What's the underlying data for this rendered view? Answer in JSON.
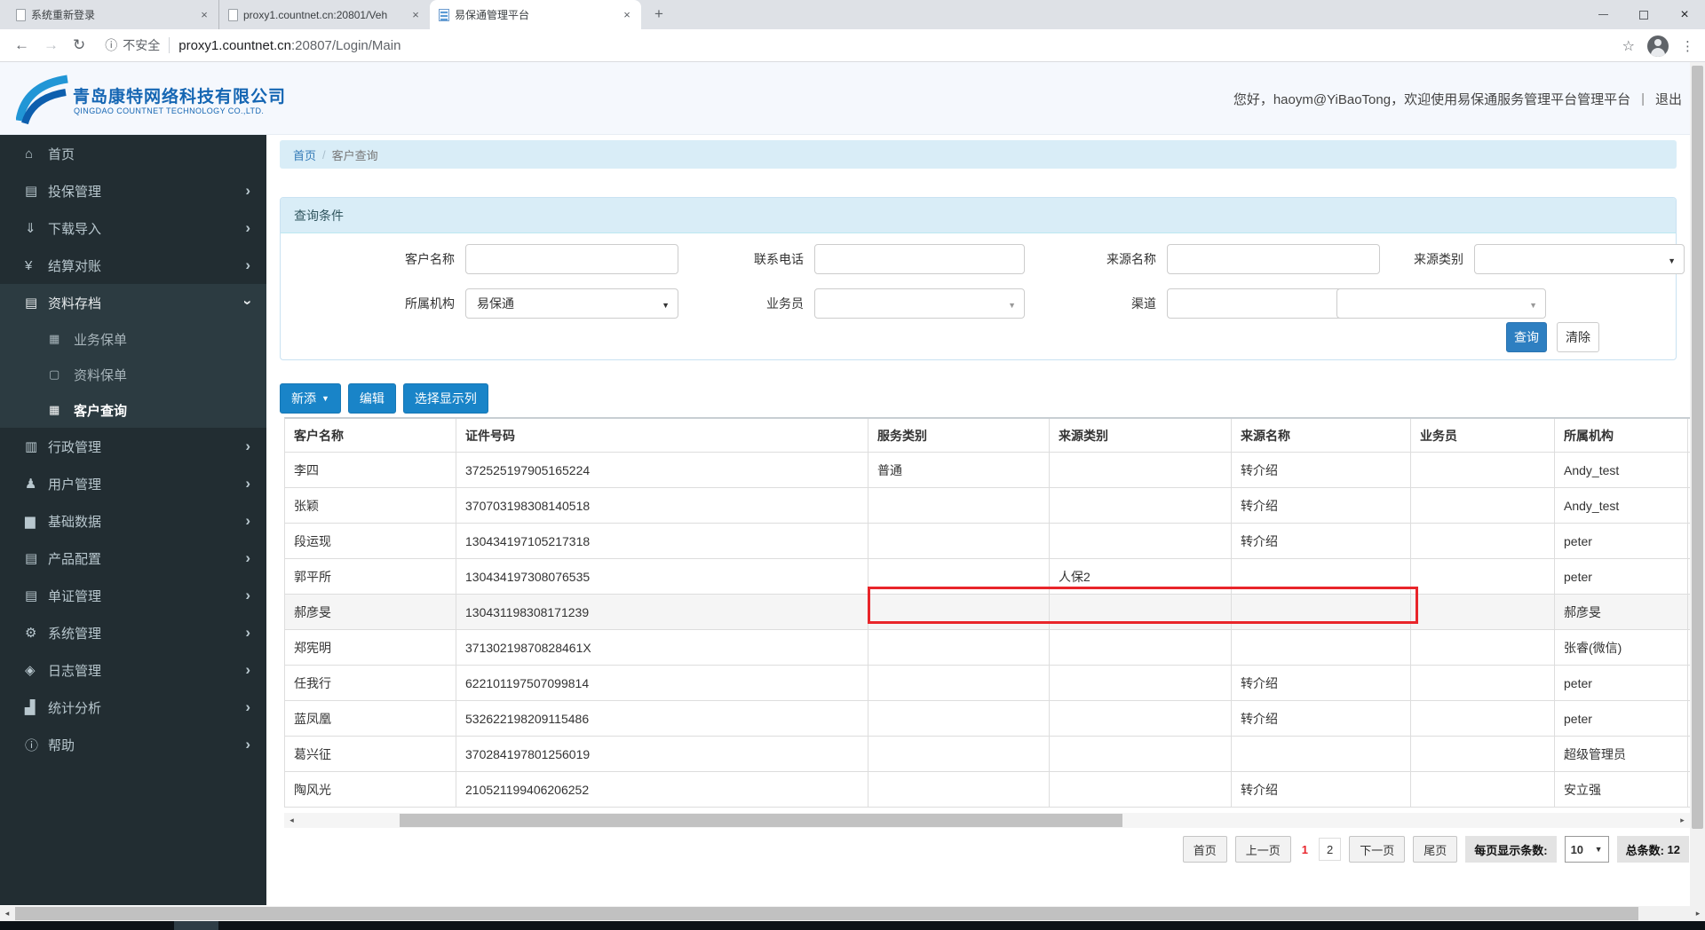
{
  "browser": {
    "tabs": [
      {
        "title": "系统重新登录",
        "active": false,
        "favicon": "page-icon"
      },
      {
        "title": "proxy1.countnet.cn:20801/Veh",
        "active": false,
        "favicon": "page-icon"
      },
      {
        "title": "易保通管理平台",
        "active": true,
        "favicon": "app-favicon"
      }
    ],
    "close_glyph": "×",
    "new_tab_glyph": "+",
    "back_glyph": "←",
    "forward_glyph": "→",
    "reload_glyph": "↻",
    "info_glyph": "ⓘ",
    "security_label": "不安全",
    "url_host": "proxy1.countnet.cn",
    "url_rest": ":20807/Login/Main",
    "star_glyph": "☆",
    "menu_glyph": "⋮",
    "close_window_glyph": "×"
  },
  "header": {
    "company_cn": "青岛康特网络科技有限公司",
    "company_en": "QINGDAO COUNTNET TECHNOLOGY CO.,LTD.",
    "welcome": "您好，haoym@YiBaoTong，欢迎使用易保通服务管理平台管理平台",
    "separator": "|",
    "logout_label": "退出"
  },
  "sidebar": {
    "items": [
      {
        "label": "首页",
        "icon": "home-icon",
        "glyph": "⌂",
        "arrow": ""
      },
      {
        "label": "投保管理",
        "icon": "policy-file-icon",
        "glyph": "▤",
        "arrow": "›"
      },
      {
        "label": "下载导入",
        "icon": "download-icon",
        "glyph": "⇓",
        "arrow": "›"
      },
      {
        "label": "结算对账",
        "icon": "yen-icon",
        "glyph": "¥",
        "arrow": "›"
      },
      {
        "label": "资料存档",
        "icon": "archive-icon",
        "glyph": "▤",
        "arrow": "›",
        "expanded": true,
        "children": [
          {
            "label": "业务保单",
            "icon": "grid-icon",
            "glyph": "▦",
            "active": false
          },
          {
            "label": "资料保单",
            "icon": "doc-icon",
            "glyph": "▢",
            "active": false
          },
          {
            "label": "客户查询",
            "icon": "grid-icon",
            "glyph": "▦",
            "active": true
          }
        ]
      },
      {
        "label": "行政管理",
        "icon": "briefcase-icon",
        "glyph": "▥",
        "arrow": "›"
      },
      {
        "label": "用户管理",
        "icon": "user-icon",
        "glyph": "♟",
        "arrow": "›"
      },
      {
        "label": "基础数据",
        "icon": "database-icon",
        "glyph": "▆",
        "arrow": "›"
      },
      {
        "label": "产品配置",
        "icon": "product-icon",
        "glyph": "▤",
        "arrow": "›"
      },
      {
        "label": "单证管理",
        "icon": "certificate-icon",
        "glyph": "▤",
        "arrow": "›"
      },
      {
        "label": "系统管理",
        "icon": "gear-icon",
        "glyph": "⚙",
        "arrow": "›"
      },
      {
        "label": "日志管理",
        "icon": "tag-icon",
        "glyph": "◈",
        "arrow": "›"
      },
      {
        "label": "统计分析",
        "icon": "chart-icon",
        "glyph": "▟",
        "arrow": "›"
      },
      {
        "label": "帮助",
        "icon": "help-icon",
        "glyph": "ⓘ",
        "arrow": "›"
      }
    ]
  },
  "breadcrumb": {
    "home": "首页",
    "separator": "/",
    "current": "客户查询"
  },
  "query": {
    "title": "查询条件",
    "labels": {
      "customer_name": "客户名称",
      "phone": "联系电话",
      "source_name": "来源名称",
      "source_type": "来源类别",
      "organization": "所属机构",
      "salesman": "业务员",
      "channel": "渠道"
    },
    "values": {
      "organization": "易保通"
    },
    "caret_glyph": "▼",
    "search_label": "查询",
    "clear_label": "清除"
  },
  "toolbar": {
    "add_label": "新添",
    "add_caret": "▼",
    "edit_label": "编辑",
    "choose_columns_label": "选择显示列"
  },
  "table": {
    "columns": [
      "客户名称",
      "证件号码",
      "服务类别",
      "来源类别",
      "来源名称",
      "业务员",
      "所属机构"
    ],
    "rows": [
      [
        "李四",
        "372525197905165224",
        "普通",
        "",
        "转介绍",
        "",
        "Andy_test"
      ],
      [
        "张颖",
        "370703198308140518",
        "",
        "",
        "转介绍",
        "",
        "Andy_test"
      ],
      [
        "段运现",
        "130434197105217318",
        "",
        "",
        "转介绍",
        "",
        "peter"
      ],
      [
        "郭平所",
        "130434197308076535",
        "",
        "人保2",
        "",
        "",
        "peter"
      ],
      [
        "郝彦旻",
        "130431198308171239",
        "",
        "",
        "",
        "",
        "郝彦旻"
      ],
      [
        "郑宪明",
        "37130219870828461X",
        "",
        "",
        "",
        "",
        "张睿(微信)"
      ],
      [
        "任我行",
        "622101197507099814",
        "",
        "",
        "转介绍",
        "",
        "peter"
      ],
      [
        "蓝凤凰",
        "532622198209115486",
        "",
        "",
        "转介绍",
        "",
        "peter"
      ],
      [
        "葛兴征",
        "370284197801256019",
        "",
        "",
        "",
        "",
        "超级管理员"
      ],
      [
        "陶风光",
        "210521199406206252",
        "",
        "",
        "转介绍",
        "",
        "安立强"
      ]
    ],
    "highlight_row_index": 4
  },
  "pagination": {
    "first": "首页",
    "prev": "上一页",
    "current_page": "1",
    "other_page": "2",
    "next": "下一页",
    "last": "尾页",
    "per_page_label": "每页显示条数:",
    "per_page_value": "10",
    "total_label": "总条数:",
    "total_value": "12"
  },
  "scroll": {
    "left_glyph": "◂",
    "right_glyph": "▸"
  },
  "colors": {
    "toolbar_blue": "#1984c8",
    "search_blue": "#2e7fc1",
    "sidebar_bg": "#222d32",
    "panel_header_bg": "#d9edf7",
    "highlight_red": "#e8252a",
    "current_page_red": "#e8262d"
  }
}
